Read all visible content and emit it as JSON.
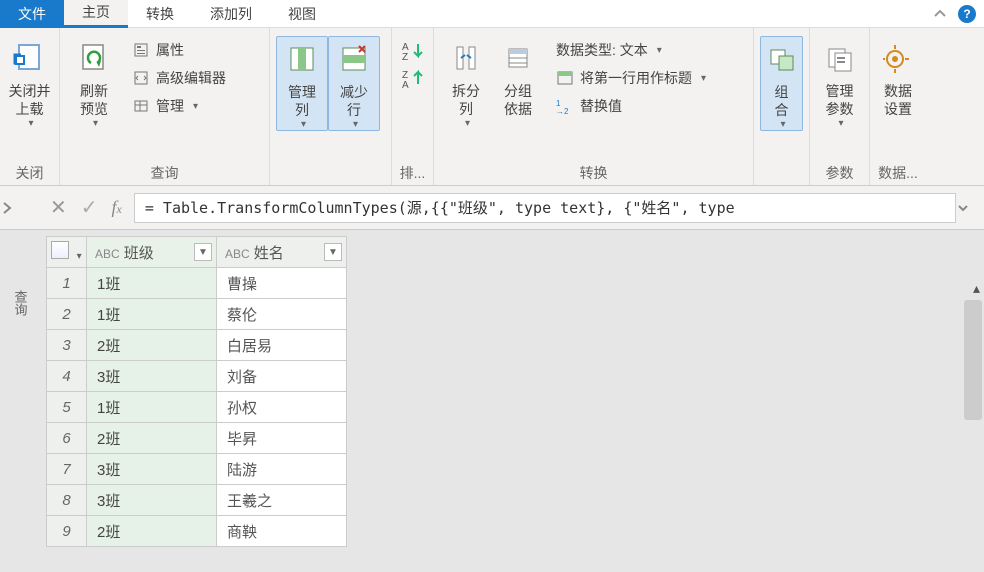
{
  "tabs": {
    "file": "文件",
    "home": "主页",
    "transform": "转换",
    "addcol": "添加列",
    "view": "视图"
  },
  "ribbon": {
    "close_group": {
      "btn": "关闭并\n上载",
      "label": "关闭"
    },
    "query_group": {
      "refresh": "刷新\n预览",
      "props": "属性",
      "adv": "高级编辑器",
      "manage": "管理",
      "label": "查询"
    },
    "cols_group": {
      "managecols": "管理\n列",
      "reducerows": "减少\n行"
    },
    "sort_group": {
      "label": "排..."
    },
    "trans_group": {
      "split": "拆分\n列",
      "groupby": "分组\n依据",
      "datatype": "数据类型: 文本",
      "firstrow": "将第一行用作标题",
      "replace": "替换值",
      "label": "转换"
    },
    "combine_group": {
      "combine": "组\n合"
    },
    "params_group": {
      "manageparams": "管理\n参数",
      "label": "参数"
    },
    "data_group": {
      "datasrc": "数据\n设置",
      "label": "数据..."
    }
  },
  "formula": "= Table.TransformColumnTypes(源,{{\"班级\", type text}, {\"姓名\", type",
  "leftPanel": "查询",
  "grid": {
    "typeprefix": "ABC",
    "col1": "班级",
    "col2": "姓名",
    "rows": [
      {
        "n": "1",
        "a": "1班",
        "b": "曹操"
      },
      {
        "n": "2",
        "a": "1班",
        "b": "蔡伦"
      },
      {
        "n": "3",
        "a": "2班",
        "b": "白居易"
      },
      {
        "n": "4",
        "a": "3班",
        "b": "刘备"
      },
      {
        "n": "5",
        "a": "1班",
        "b": "孙权"
      },
      {
        "n": "6",
        "a": "2班",
        "b": "毕昇"
      },
      {
        "n": "7",
        "a": "3班",
        "b": "陆游"
      },
      {
        "n": "8",
        "a": "3班",
        "b": "王羲之"
      },
      {
        "n": "9",
        "a": "2班",
        "b": "商鞅"
      }
    ]
  }
}
